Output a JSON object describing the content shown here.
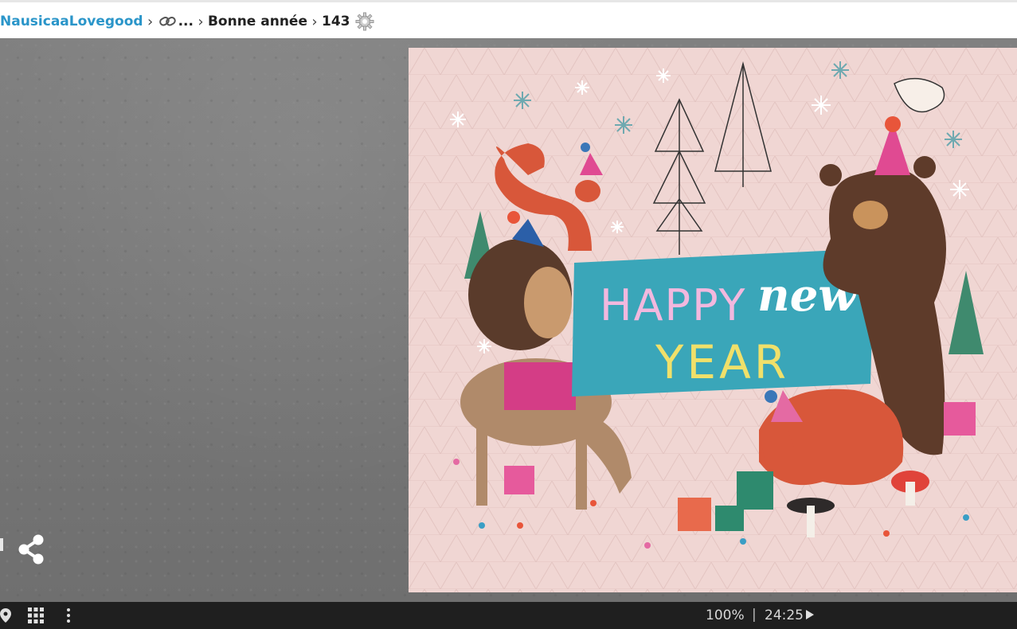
{
  "breadcrumb": {
    "user": "NausicaaLovegood",
    "ellipsis": "...",
    "album": "Bonne année",
    "page_number": "143"
  },
  "card": {
    "line1": "HAPPY",
    "line2": "new",
    "line3": "YEAR"
  },
  "player": {
    "zoom": "100%",
    "separator": "|",
    "time": "24:25"
  },
  "colors": {
    "link": "#2a95c9",
    "card_bg": "#f0d6d3",
    "banner": "#3aa6b9",
    "bar": "#1f1f1f"
  },
  "icons": [
    "link-icon",
    "gear-icon",
    "share-icon",
    "location-icon",
    "grid-icon",
    "more-icon",
    "play-icon"
  ]
}
